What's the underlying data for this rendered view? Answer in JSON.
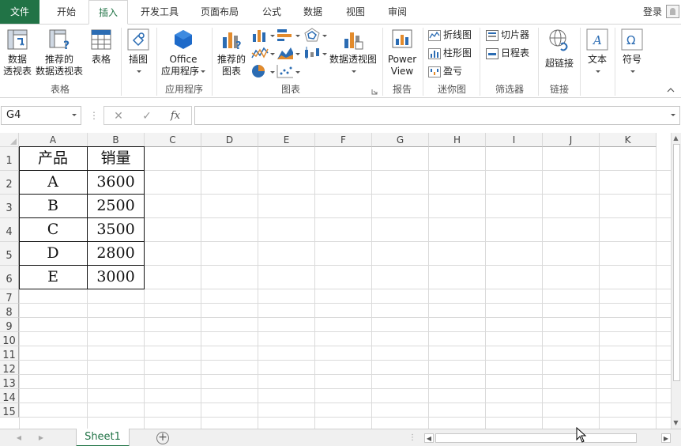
{
  "tabs": [
    {
      "label": "文件",
      "kind": "file"
    },
    {
      "label": "开始"
    },
    {
      "label": "插入",
      "active": true
    },
    {
      "label": "开发工具"
    },
    {
      "label": "页面布局"
    },
    {
      "label": "公式"
    },
    {
      "label": "数据"
    },
    {
      "label": "视图"
    },
    {
      "label": "审阅"
    }
  ],
  "account": {
    "login_label": "登录"
  },
  "ribbon": {
    "tables": {
      "group_label": "表格",
      "pivot_table": {
        "line1": "数据",
        "line2": "透视表"
      },
      "recommended_pivot": {
        "line1": "推荐的",
        "line2": "数据透视表"
      },
      "table": {
        "label": "表格"
      }
    },
    "illustrations": {
      "label": "插图"
    },
    "apps": {
      "group_label": "应用程序",
      "office_apps": {
        "line1": "Office",
        "line2": "应用程序"
      }
    },
    "charts": {
      "group_label": "图表",
      "recommended": {
        "line1": "推荐的",
        "line2": "图表"
      },
      "pivot_chart": {
        "label": "数据透视图"
      }
    },
    "reports": {
      "group_label": "报告",
      "power_view": {
        "line1": "Power",
        "line2": "View"
      }
    },
    "sparklines": {
      "group_label": "迷你图",
      "line": "折线图",
      "column": "柱形图",
      "winloss": "盈亏"
    },
    "filters": {
      "group_label": "筛选器",
      "slicer": "切片器",
      "timeline": "日程表"
    },
    "links": {
      "group_label": "链接",
      "hyperlink": "超链接"
    },
    "text": {
      "label": "文本"
    },
    "symbols": {
      "label": "符号"
    }
  },
  "formula_bar": {
    "name_box": "G4",
    "fx_label": "fx",
    "formula": ""
  },
  "sheet": {
    "columns": [
      "A",
      "B",
      "C",
      "D",
      "E",
      "F",
      "G",
      "H",
      "I",
      "J",
      "K"
    ],
    "rows": [
      "1",
      "2",
      "3",
      "4",
      "5",
      "6",
      "7",
      "8",
      "9",
      "10",
      "11",
      "12",
      "13",
      "14",
      "15"
    ],
    "table": [
      [
        "产品",
        "销量"
      ],
      [
        "A",
        "3600"
      ],
      [
        "B",
        "2500"
      ],
      [
        "C",
        "3500"
      ],
      [
        "D",
        "2800"
      ],
      [
        "E",
        "3000"
      ]
    ]
  },
  "sheet_tabs": [
    {
      "label": "Sheet1",
      "active": true
    }
  ],
  "colors": {
    "accent": "#217346",
    "table_border": "#111111",
    "gridline": "#dadada"
  }
}
